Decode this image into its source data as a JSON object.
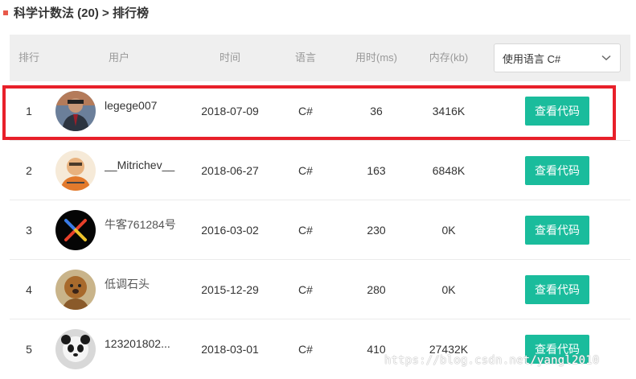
{
  "page_title": "科学计数法 (20) > 排行榜",
  "header": {
    "rank": "排行",
    "user": "用户",
    "time": "时间",
    "language": "语言",
    "time_used": "用时(ms)",
    "memory": "内存(kb)"
  },
  "language_select": {
    "value": "使用语言 C#"
  },
  "rows": [
    {
      "rank": "1",
      "user": "legege007",
      "date": "2018-07-09",
      "lang": "C#",
      "ms": "36",
      "kb": "3416K",
      "button": "查看代码"
    },
    {
      "rank": "2",
      "user": "__Mitrichev__",
      "date": "2018-06-27",
      "lang": "C#",
      "ms": "163",
      "kb": "6848K",
      "button": "查看代码"
    },
    {
      "rank": "3",
      "user": "牛客761284号",
      "date": "2016-03-02",
      "lang": "C#",
      "ms": "230",
      "kb": "0K",
      "button": "查看代码"
    },
    {
      "rank": "4",
      "user": "低调石头",
      "date": "2015-12-29",
      "lang": "C#",
      "ms": "280",
      "kb": "0K",
      "button": "查看代码"
    },
    {
      "rank": "5",
      "user": "123201802...",
      "date": "2018-03-01",
      "lang": "C#",
      "ms": "410",
      "kb": "27432K",
      "button": "查看代码"
    }
  ],
  "watermark": "https://blog.csdn.net/yangl2010",
  "colors": {
    "accent_button": "#1abc9c",
    "highlight_border": "#e8202a",
    "title_mark": "#e8594a"
  }
}
